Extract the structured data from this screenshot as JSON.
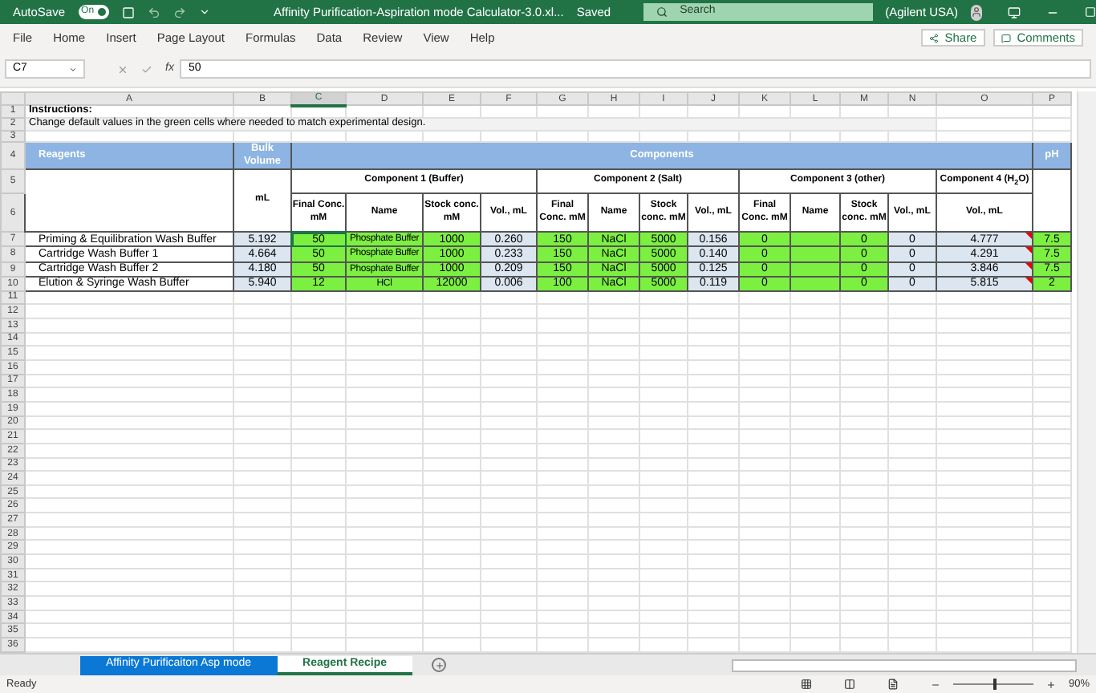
{
  "title_bar": {
    "autosave_label": "AutoSave",
    "autosave_toggle": {
      "label": "On",
      "on": true
    },
    "document_title": "Affinity Purification-Aspiration mode Calculator-3.0.xl...",
    "save_status": "Saved",
    "search_placeholder": "Search",
    "account": "(Agilent USA)"
  },
  "menu": [
    {
      "label": "File",
      "selected": false
    },
    {
      "label": "Home",
      "selected": false
    },
    {
      "label": "Insert",
      "selected": false
    },
    {
      "label": "Page Layout",
      "selected": false
    },
    {
      "label": "Formulas",
      "selected": false
    },
    {
      "label": "Data",
      "selected": false
    },
    {
      "label": "Review",
      "selected": false
    },
    {
      "label": "View",
      "selected": false
    },
    {
      "label": "Help",
      "selected": false
    }
  ],
  "ribbon_buttons": {
    "share": "Share",
    "comments": "Comments"
  },
  "formula_bar": {
    "name_box": "C7",
    "function_label": "fx",
    "formula": "50"
  },
  "columns": [
    "A",
    "B",
    "C",
    "D",
    "E",
    "F",
    "G",
    "H",
    "I",
    "J",
    "K",
    "L",
    "M",
    "N",
    "O",
    "P"
  ],
  "row_numbers": [
    "1",
    "2",
    "3",
    "4",
    "5",
    "6",
    "7",
    "8",
    "9",
    "10",
    "11",
    "12",
    "13",
    "14",
    "15",
    "16",
    "17",
    "18",
    "19",
    "20",
    "21",
    "22",
    "23",
    "24",
    "25",
    "26",
    "27",
    "28",
    "29",
    "30",
    "31",
    "32",
    "33",
    "34",
    "35",
    "36"
  ],
  "sheet": {
    "instructions_title": "Instructions:",
    "instructions_text": "Change default values in the green cells where needed to match experimental design.",
    "header": {
      "reagents": "Reagents",
      "bulk_volume": "Bulk Volume",
      "components": "Components",
      "ph": "pH",
      "unit": "mL",
      "groups": [
        "Component 1 (Buffer)",
        "Component 2 (Salt)",
        "Component 3 (other)",
        "Component 4 (H$_{2}$O)"
      ],
      "subheaders": [
        "Final Conc. mM",
        "Name",
        "Stock conc. mM",
        "Vol., mL",
        "Final Conc. mM",
        "Name",
        "Stock conc. mM",
        "Vol., mL",
        "Final Conc. mM",
        "Name",
        "Stock conc. mM",
        "Vol., mL",
        "Vol., mL"
      ]
    },
    "cell_kinds": [
      {
        "kind": "label"
      },
      {
        "kind": "calc"
      },
      {
        "kind": "input"
      },
      {
        "kind": "input"
      },
      {
        "kind": "input"
      },
      {
        "kind": "calc"
      },
      {
        "kind": "input"
      },
      {
        "kind": "input"
      },
      {
        "kind": "input"
      },
      {
        "kind": "calc"
      },
      {
        "kind": "input"
      },
      {
        "kind": "input"
      },
      {
        "kind": "input"
      },
      {
        "kind": "calc"
      },
      {
        "kind": "note"
      },
      {
        "kind": "input"
      }
    ],
    "rows": [
      {
        "cells": [
          {
            "v": "Priming & Equilibration Wash Buffer",
            "selected": false
          },
          {
            "v": "5.192",
            "selected": false
          },
          {
            "v": "50",
            "selected": true
          },
          {
            "v": "Phosphate Buffer",
            "selected": false
          },
          {
            "v": "1000",
            "selected": false
          },
          {
            "v": "0.260",
            "selected": false
          },
          {
            "v": "150",
            "selected": false
          },
          {
            "v": "NaCl",
            "selected": false
          },
          {
            "v": "5000",
            "selected": false
          },
          {
            "v": "0.156",
            "selected": false
          },
          {
            "v": "0",
            "selected": false
          },
          {
            "selected": false
          },
          {
            "v": "0",
            "selected": false
          },
          {
            "v": "0",
            "selected": false
          },
          {
            "v": "4.777",
            "selected": false
          },
          {
            "v": "7.5",
            "selected": false
          }
        ]
      },
      {
        "cells": [
          {
            "v": "Cartridge Wash Buffer 1",
            "selected": false
          },
          {
            "v": "4.664",
            "selected": false
          },
          {
            "v": "50",
            "selected": false
          },
          {
            "v": "Phosphate Buffer",
            "selected": false
          },
          {
            "v": "1000",
            "selected": false
          },
          {
            "v": "0.233",
            "selected": false
          },
          {
            "v": "150",
            "selected": false
          },
          {
            "v": "NaCl",
            "selected": false
          },
          {
            "v": "5000",
            "selected": false
          },
          {
            "v": "0.140",
            "selected": false
          },
          {
            "v": "0",
            "selected": false
          },
          {
            "selected": false
          },
          {
            "v": "0",
            "selected": false
          },
          {
            "v": "0",
            "selected": false
          },
          {
            "v": "4.291",
            "selected": false
          },
          {
            "v": "7.5",
            "selected": false
          }
        ]
      },
      {
        "cells": [
          {
            "v": "Cartridge Wash Buffer 2",
            "selected": false
          },
          {
            "v": "4.180",
            "selected": false
          },
          {
            "v": "50",
            "selected": false
          },
          {
            "v": "Phosphate Buffer",
            "selected": false
          },
          {
            "v": "1000",
            "selected": false
          },
          {
            "v": "0.209",
            "selected": false
          },
          {
            "v": "150",
            "selected": false
          },
          {
            "v": "NaCl",
            "selected": false
          },
          {
            "v": "5000",
            "selected": false
          },
          {
            "v": "0.125",
            "selected": false
          },
          {
            "v": "0",
            "selected": false
          },
          {
            "selected": false
          },
          {
            "v": "0",
            "selected": false
          },
          {
            "v": "0",
            "selected": false
          },
          {
            "v": "3.846",
            "selected": false
          },
          {
            "v": "7.5",
            "selected": false
          }
        ]
      },
      {
        "cells": [
          {
            "v": "Elution & Syringe Wash Buffer",
            "selected": false
          },
          {
            "v": "5.940",
            "selected": false
          },
          {
            "v": "12",
            "selected": false
          },
          {
            "v": "HCl",
            "selected": false
          },
          {
            "v": "12000",
            "selected": false
          },
          {
            "v": "0.006",
            "selected": false
          },
          {
            "v": "100",
            "selected": false
          },
          {
            "v": "NaCl",
            "selected": false
          },
          {
            "v": "5000",
            "selected": false
          },
          {
            "v": "0.119",
            "selected": false
          },
          {
            "v": "0",
            "selected": false
          },
          {
            "selected": false
          },
          {
            "v": "0",
            "selected": false
          },
          {
            "v": "0",
            "selected": false
          },
          {
            "v": "5.815",
            "selected": false
          },
          {
            "v": "2",
            "selected": false
          }
        ]
      }
    ]
  },
  "sheet_tabs": [
    {
      "label": "Affinity Purificaiton Asp mode",
      "selected": false
    },
    {
      "label": "Reagent Recipe",
      "selected": true
    }
  ],
  "status_bar": {
    "status": "Ready",
    "zoom_slider": {
      "level": 0.5
    },
    "zoom": "90%"
  }
}
